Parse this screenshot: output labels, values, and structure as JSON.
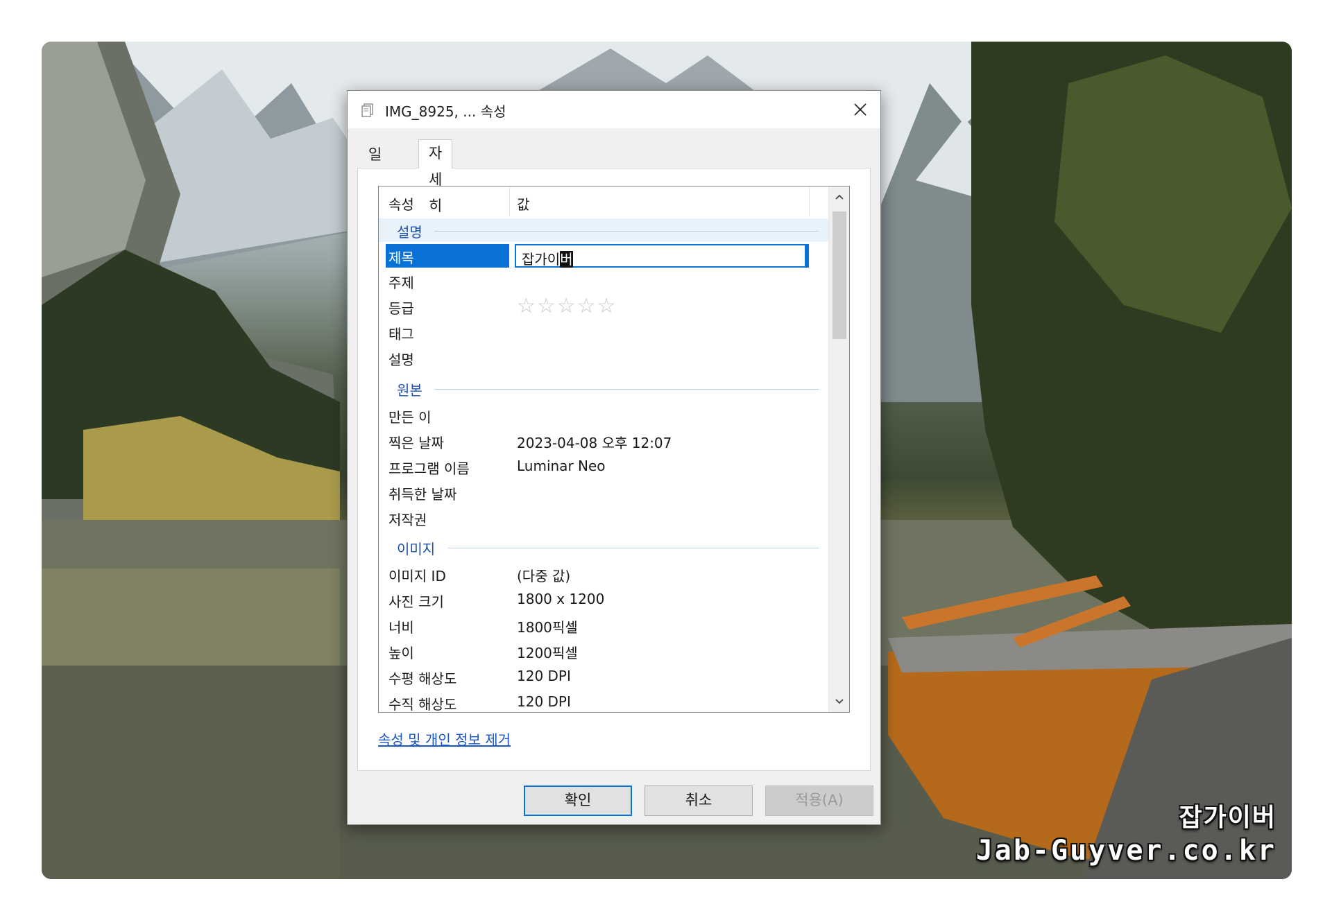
{
  "dialog": {
    "title": "IMG_8925, ... 속성",
    "tabs": {
      "general": "일반",
      "details": "자세히"
    },
    "columns": {
      "property": "속성",
      "value": "값"
    },
    "groups": {
      "description": "설명",
      "origin": "원본",
      "image": "이미지"
    },
    "rows": {
      "title": {
        "key": "제목",
        "value_prefix": "잡가이",
        "value_selected": "버"
      },
      "subject": {
        "key": "주제",
        "value": ""
      },
      "rating": {
        "key": "등급",
        "stars": "☆☆☆☆☆",
        "value": 0,
        "max": 5
      },
      "tags": {
        "key": "태그",
        "value": ""
      },
      "comments": {
        "key": "설명",
        "value": ""
      },
      "authors": {
        "key": "만든 이",
        "value": ""
      },
      "date_taken": {
        "key": "찍은 날짜",
        "value": "2023-04-08 오후 12:07"
      },
      "program_name": {
        "key": "프로그램 이름",
        "value": "Luminar Neo"
      },
      "date_acquired": {
        "key": "취득한 날짜",
        "value": ""
      },
      "copyright": {
        "key": "저작권",
        "value": ""
      },
      "image_id": {
        "key": "이미지 ID",
        "value": "(다중 값)"
      },
      "dimensions": {
        "key": "사진 크기",
        "value": "1800 x 1200"
      },
      "width": {
        "key": "너비",
        "value": "1800픽셀"
      },
      "height": {
        "key": "높이",
        "value": "1200픽셀"
      },
      "h_resolution": {
        "key": "수평 해상도",
        "value": "120 DPI"
      },
      "v_resolution": {
        "key": "수직 해상도",
        "value": "120 DPI"
      }
    },
    "remove_link": "속성 및 개인 정보 제거",
    "buttons": {
      "ok": "확인",
      "cancel": "취소",
      "apply": "적용(A)"
    }
  },
  "watermark": {
    "korean": "잡가이버",
    "site": "Jab-Guyver.co.kr"
  },
  "colors": {
    "selection": "#0a72d6",
    "group_text": "#1e4fa8",
    "link": "#1a56c4"
  }
}
